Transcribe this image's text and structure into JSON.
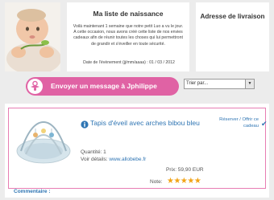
{
  "info": {
    "title": "Ma liste de naissance",
    "text": "Voilà maintenant 1 semaine que notre petit Luo a vu le jour. A cette occasion, nous avons créé cette liste de nos envies cadeaux afin de réunir toutes les choses qui lui permettront de grandir et s'éveiller en toute sécurité.",
    "date_label": "Date de l'évènement (jj/mm/aaaa) : 01 / 03 / 2012"
  },
  "address": {
    "title": "Adresse de livraison"
  },
  "message_button": {
    "label": "Envoyer un message à Jphilippe"
  },
  "sort": {
    "selected": "Trier par..."
  },
  "product": {
    "title": "Tapis d'éveil avec arches bibou bleu",
    "quantity": "Quantité:  1",
    "details_label": "Voir détails:",
    "details_link": "www.allobebe.fr",
    "price": "Prix: 59,90 EUR",
    "note_label": "Note:",
    "stars": "★★★★★",
    "reserve": "Réserver / Offrir ce cadeau"
  },
  "comment_label": "Commentaire :",
  "colors": {
    "accent_pink": "#e062a4",
    "link_blue": "#2f75b3",
    "star_orange": "#f2a316"
  },
  "icons": [
    "baby-photo",
    "pacifier-icon",
    "info-icon",
    "check-icon",
    "product-photo",
    "chevron-down-icon"
  ]
}
